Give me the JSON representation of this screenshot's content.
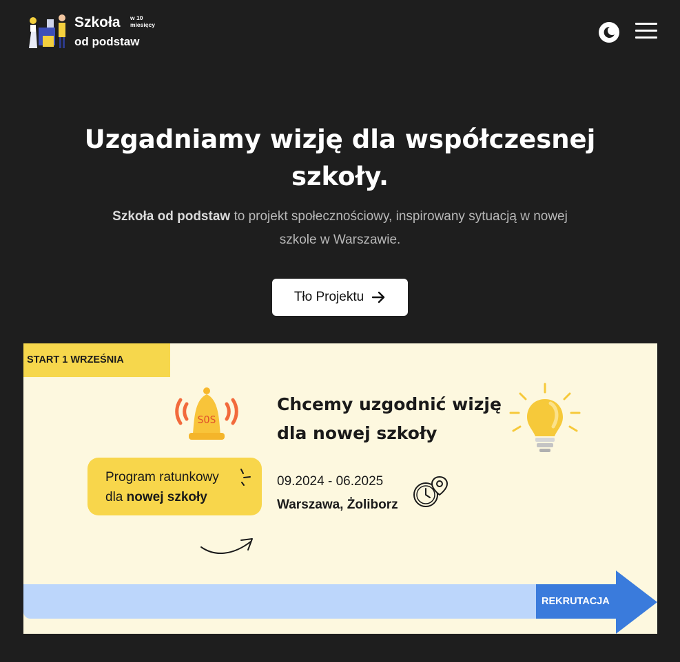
{
  "logo": {
    "title": "Szkoła",
    "small_line1": "w 10",
    "small_line2": "miesięcy",
    "subtitle": "od podstaw"
  },
  "header": {
    "theme_toggle_icon": "moon-icon",
    "menu_icon": "hamburger-menu-icon"
  },
  "hero": {
    "title": "Uzgadniamy wizję dla współczesnej szkoły.",
    "description_bold": "Szkoła od podstaw",
    "description_rest": " to projekt społecznościowy, inspirowany sytuacją w nowej szkole w Warszawie.",
    "cta_label": "Tło Projektu",
    "cta_icon": "arrow-right-icon"
  },
  "banner": {
    "start_tag": "START 1 WRZEŚNIA",
    "bell_text": "SOS",
    "program_line1": "Program ratunkowy",
    "program_line2_prefix": "dla ",
    "program_line2_bold": "nowej szkoły",
    "title_line1": "Chcemy uzgodnić wizję",
    "title_line2": "dla nowej szkoły",
    "dates": "09.2024 - 06.2025",
    "place": "Warszawa, Żoliborz",
    "recruitment": "REKRUTACJA"
  },
  "colors": {
    "page_bg": "#1e1e1e",
    "banner_bg": "#fdf8df",
    "yellow": "#f6d74c",
    "blue_bar": "#bcd6fb",
    "blue_arrow": "#3a7bdc",
    "bell_waves": "#f26a3c"
  }
}
